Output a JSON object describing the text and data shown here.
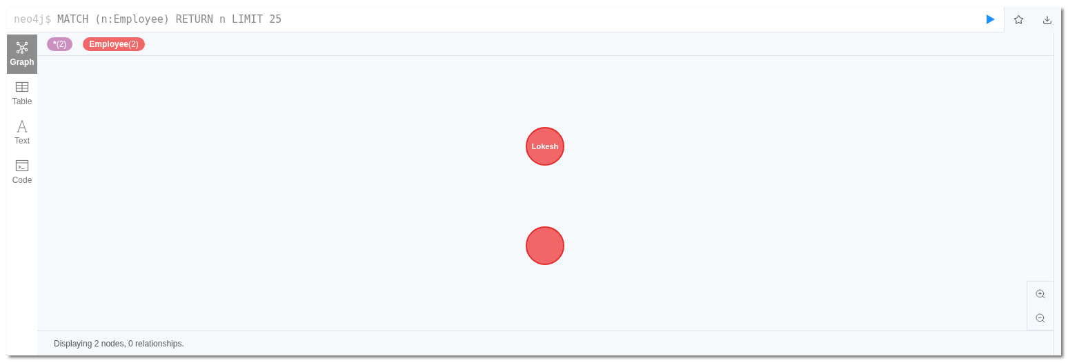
{
  "editor": {
    "prompt": "neo4j$",
    "query": "MATCH (n:Employee) RETURN n LIMIT 25"
  },
  "sidebar": {
    "items": [
      {
        "kind": "graph",
        "label": "Graph",
        "selected": true
      },
      {
        "kind": "table",
        "label": "Table",
        "selected": false
      },
      {
        "kind": "text",
        "label": "Text",
        "selected": false
      },
      {
        "kind": "code",
        "label": "Code",
        "selected": false
      }
    ]
  },
  "labels": [
    {
      "name": "*",
      "count": "(2)",
      "color": "#c990c0"
    },
    {
      "name": "Employee",
      "count": "(2)",
      "color": "#f16667"
    }
  ],
  "graph": {
    "nodes": [
      {
        "caption": "Lokesh",
        "color": "#f16667"
      },
      {
        "color": "#f16667"
      }
    ]
  },
  "status_bar": "Displaying 2 nodes, 0 relationships."
}
